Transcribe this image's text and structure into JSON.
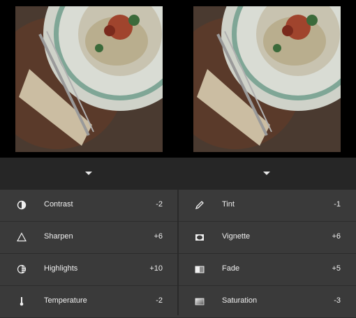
{
  "left": {
    "photo_icon": "food-photo",
    "adjustments": [
      {
        "label": "Contrast",
        "value": "-2",
        "icon": "contrast-icon"
      },
      {
        "label": "Sharpen",
        "value": "+6",
        "icon": "triangle-icon"
      },
      {
        "label": "Highlights",
        "value": "+10",
        "icon": "highlights-icon"
      },
      {
        "label": "Temperature",
        "value": "-2",
        "icon": "thermometer-icon"
      }
    ]
  },
  "right": {
    "photo_icon": "food-photo",
    "adjustments": [
      {
        "label": "Tint",
        "value": "-1",
        "icon": "pencil-icon"
      },
      {
        "label": "Vignette",
        "value": "+6",
        "icon": "vignette-icon"
      },
      {
        "label": "Fade",
        "value": "+5",
        "icon": "fade-icon"
      },
      {
        "label": "Saturation",
        "value": "-3",
        "icon": "saturation-icon"
      }
    ]
  }
}
